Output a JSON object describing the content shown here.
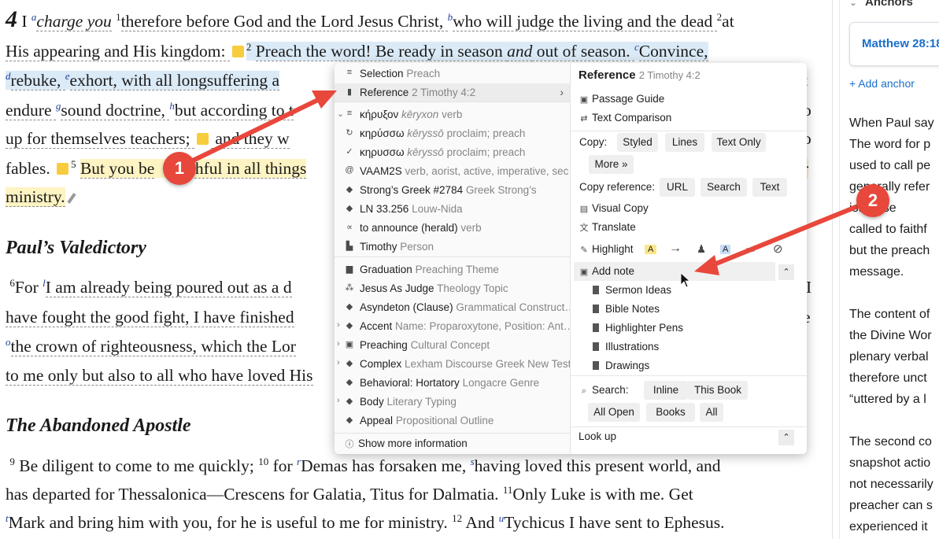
{
  "bible": {
    "chapter_number": "4",
    "lines": {
      "l1": {
        "a": "I ",
        "fa": "a",
        "b": "charge ",
        "c": "you",
        "v1": "1",
        "d": "therefore before God and the Lord Jesus Christ, ",
        "fb": "b",
        "e": "who will judge the living and the dead ",
        "v2": "2",
        "f": "at"
      },
      "l2": {
        "a": "His appearing and His kingdom: ",
        "v2": "2",
        "b": "Preach the word! Be ready in season ",
        "c": "and",
        "d": " out of season. ",
        "fc": "c",
        "e": "Convince,"
      },
      "l3": {
        "fd": "d",
        "a": "rebuke, ",
        "fe": "e",
        "b": "exhort, with all longsuffering a",
        "tail": "t"
      },
      "l4": {
        "a": "endure ",
        "fg": "g",
        "b": "sound doctrine, ",
        "fh": "h",
        "c": "but according to t",
        "tail": "o"
      },
      "l5": {
        "a": "up for themselves teachers; ",
        "b": " and they w",
        "tail": "o"
      },
      "l6": {
        "a": "fables. ",
        "v5": "5",
        "b": "But you be",
        "c": "tchful in all things",
        "tail": "r"
      },
      "l7": {
        "a": "ministry."
      },
      "l8": {
        "v6": "6",
        "a": "For ",
        "fl": "l",
        "b": "I am already being poured out as a d",
        "tail": "I"
      },
      "l9": {
        "a": "have fought the good fight, I have finished",
        "tail": "e"
      },
      "l10": {
        "fo": "o",
        "a": "the crown of righteousness, which the Lor"
      },
      "l11": {
        "a": "to me only but also to all who have loved His"
      },
      "l12": {
        "v9": "9",
        "a": "Be diligent to come to me quickly; ",
        "v10": "10",
        "b": " for ",
        "fr": "r",
        "c": "Demas has forsaken me, ",
        "fs": "s",
        "d": "having loved this present world, and"
      },
      "l13": {
        "a": "has departed for Thessalonica—Crescens for Galatia, Titus for Dalmatia. ",
        "v11": "11",
        "b": "Only Luke is with me. Get"
      },
      "l14": {
        "ft": "t",
        "a": "Mark and bring him with you, for he is useful to me for ministry. ",
        "v12": "12",
        "b": " And ",
        "fu": "u",
        "c": "Tychicus I have sent to Ephesus."
      }
    },
    "heading1": "Paul’s Valedictory",
    "heading2": "The Abandoned Apostle"
  },
  "right_panel": {
    "title": "Anchors",
    "anchor_card": "Matthew 28:18",
    "add_anchor": "+ Add anchor",
    "text_lines": [
      "When Paul say",
      "The word for p",
      "used to call pe",
      "generally refer",
      "ist tense",
      "called to faithf",
      "but the preach",
      "message.",
      "",
      "The content of",
      "the Divine Wor",
      "plenary verbal",
      "therefore unct",
      "“uttered by a l",
      "",
      "The second co",
      "snapshot actio",
      "not necessarily",
      "preacher can s",
      "experienced it"
    ]
  },
  "popup": {
    "left_items": [
      {
        "icon": "≡",
        "label": "Selection",
        "sub": "Preach"
      },
      {
        "icon": "▮",
        "label": "Reference",
        "sub": "2 Timothy 4:2",
        "arrow": "›"
      },
      {
        "icon": "≡",
        "label": "κήρυξον",
        "sub": "kēryxon verb",
        "expand": "⌄"
      },
      {
        "icon": "↻",
        "label": "κηρύσσω",
        "sub": "kēryssō proclaim; preach"
      },
      {
        "icon": "✓",
        "label": "κηρυσσω",
        "sub": "kēryssō proclaim; preach"
      },
      {
        "icon": "@",
        "label": "VAAM2S",
        "sub": "verb, aorist, active, imperative, sec…"
      },
      {
        "icon": "◆",
        "label": "Strong’s Greek #2784",
        "sub": "Greek Strong’s"
      },
      {
        "icon": "◆",
        "label": "LN 33.256",
        "sub": "Louw-Nida"
      },
      {
        "icon": "∝",
        "label": "to announce (herald)",
        "sub": "verb"
      },
      {
        "icon": "▙",
        "label": "Timothy",
        "sub": "Person"
      },
      {
        "icon": "▆",
        "label": "Graduation",
        "sub": "Preaching Theme"
      },
      {
        "icon": "⁂",
        "label": "Jesus As Judge",
        "sub": "Theology Topic"
      },
      {
        "icon": "◆",
        "label": "Asyndeton (Clause)",
        "sub": "Grammatical Construct…"
      },
      {
        "icon": "◆",
        "label": "Accent",
        "sub": "Name: Proparoxytone, Position: Ant…",
        "expand": "›"
      },
      {
        "icon": "▣",
        "label": "Preaching",
        "sub": "Cultural Concept",
        "expand": "›"
      },
      {
        "icon": "◆",
        "label": "Complex",
        "sub": "Lexham Discourse Greek New Test…",
        "expand": "›"
      },
      {
        "icon": "◆",
        "label": "Behavioral: Hortatory",
        "sub": "Longacre Genre"
      },
      {
        "icon": "◆",
        "label": "Body",
        "sub": "Literary Typing",
        "expand": "›"
      },
      {
        "icon": "◆",
        "label": "Appeal",
        "sub": "Propositional Outline"
      }
    ],
    "show_more": "Show more information",
    "right": {
      "reference_title": "Reference",
      "reference_sub": "2 Timothy 4:2",
      "passage_guide": "Passage Guide",
      "text_comparison": "Text Comparison",
      "copy_label": "Copy:",
      "copy_buttons": [
        "Styled",
        "Lines",
        "Text Only",
        "More »"
      ],
      "copy_ref_label": "Copy reference:",
      "copy_ref_buttons": [
        "URL",
        "Search",
        "Text"
      ],
      "visual_copy": "Visual Copy",
      "translate": "Translate",
      "highlight": "Highlight",
      "add_note": "Add note",
      "notebooks": [
        "Sermon Ideas",
        "Bible Notes",
        "Highlighter Pens",
        "Illustrations",
        "Drawings"
      ],
      "search_label": "Search:",
      "search_buttons": [
        "Inline",
        "This Book",
        "All Open",
        "Books",
        "All"
      ],
      "look_up": "Look up"
    }
  },
  "callouts": [
    "1",
    "2"
  ]
}
